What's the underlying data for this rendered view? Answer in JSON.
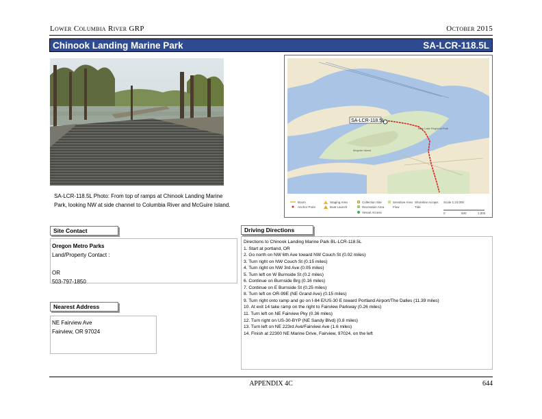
{
  "header": {
    "left": "Lower Columbia River GRP",
    "right": "October 2015"
  },
  "title": {
    "name": "Chinook Landing Marine Park",
    "id": "SA-LCR-118.5L"
  },
  "photo": {
    "caption": "SA-LCR-118.5L Photo: From top of ramps at Chinook Landing Marine Park, looking NW at side channel to Columbia River and McGuire Island."
  },
  "map": {
    "site_label": "SA-LCR-118.5L",
    "area_labels": [
      "Mcguire Island",
      "Blue Lake Regional Park"
    ],
    "legend": [
      "Boom",
      "Anchor Point",
      "Staging Area",
      "Boat Launch",
      "Collection Site",
      "Recreation Area",
      "Vessel Access",
      "Sensitive Area",
      "Flow",
      "Shoreline Access",
      "Tide"
    ],
    "scale_note": "Scale 1:24,000",
    "scale_ticks": [
      "0",
      "500",
      "1,000"
    ]
  },
  "site_contact": {
    "label": "Site Contact",
    "org": "Oregon Metro Parks",
    "contact": "Land/Property Contact :",
    "state": "OR",
    "phone": "503-797-1850"
  },
  "nearest_address": {
    "label": "Nearest Address",
    "line1": "NE Fairview Ave",
    "line2": "Fairview, OR 97024"
  },
  "driving": {
    "label": "Driving Directions",
    "lines": [
      "Directions to Chinook Landing Marine Park BL-LCR-118.5L",
      "1. Start at portland, OR",
      "2. Go north on NW 6th Ave toward NW Couch St (0.02 miles)",
      "3. Turn right on NW Couch St (0.15 miles)",
      "4. Turn right on NW 3rd Ave (0.05 miles)",
      "5. Turn left on W Burnside St (0.2 miles)",
      "6. Continue on Burnside Brg (0.16 miles)",
      "7. Continue on E Burnside St (0.25 miles)",
      "8. Turn left on OR-99E (NE Grand Ave) (0.15 miles)",
      "9. Turn right onto ramp and go on I-84 E/US-30 E toward Portland Airport/The Dalles (11.39 miles)",
      "10. At exit 14 take ramp on the right to Fairview Parkway (0.26 miles)",
      "11. Turn left on NE Fairview Pky (0.36 miles)",
      "12. Turn right on US-30-BYP (NE Sandy Blvd) (0.8 miles)",
      "13. Turn left on NE 223rd Ave/Fairview Ave (1.6 miles)",
      "14. Finish at 22300 NE Marine Drive, Fairview, 97024, on the left"
    ]
  },
  "footer": {
    "center": "APPENDIX 4C",
    "page": "644"
  },
  "colors": {
    "title_bar": "#2e4a91",
    "route": "#e0221c",
    "water": "#a9c4e4",
    "land": "#efe7cf"
  }
}
